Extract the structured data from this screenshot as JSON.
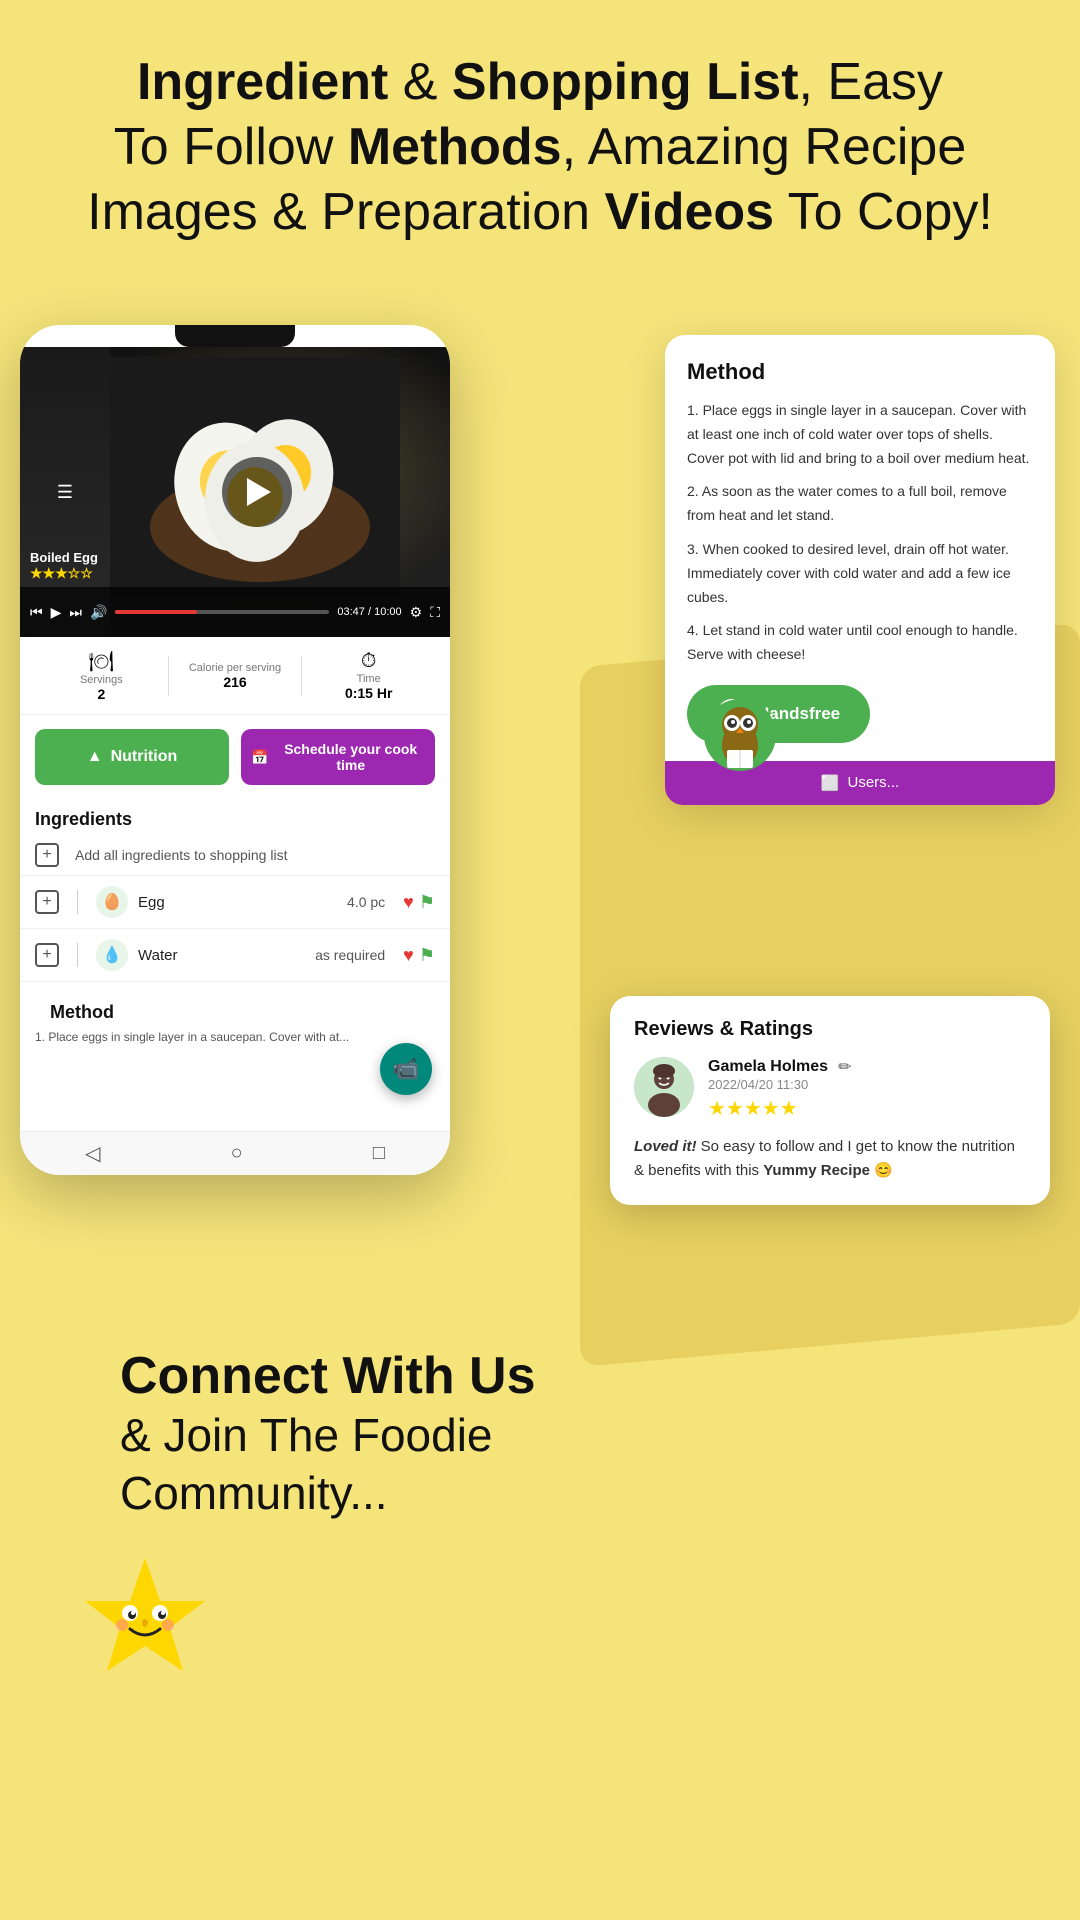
{
  "header": {
    "line1_normal": "Ingredient",
    "line1_connector": " & ",
    "line1_bold": "Shopping List",
    "line1_end": ", Easy",
    "line2_start": "To Follow ",
    "line2_bold": "Methods",
    "line2_end": ", Amazing Recipe",
    "line3_start": "Images & Preparation ",
    "line3_bold": "Videos",
    "line3_end": " To Copy!"
  },
  "recipe": {
    "title": "Boiled Egg",
    "rating_stars": "★★★☆☆",
    "video_time_current": "03:47",
    "video_time_total": "10:00",
    "servings_label": "Servings",
    "servings_value": "2",
    "calorie_label": "Calorie per serving",
    "calorie_value": "216",
    "time_label": "Time",
    "time_value": "0:15 Hr"
  },
  "buttons": {
    "nutrition_label": "Nutrition",
    "schedule_label": "Schedule your cook time",
    "handsfree_label": "Handsfree",
    "add_shopping": "Add all ingredients to shopping list"
  },
  "ingredients": {
    "title": "Ingredients",
    "items": [
      {
        "name": "Egg",
        "quantity": "4.0 pc",
        "icon": "🥚"
      },
      {
        "name": "Water",
        "quantity": "as required",
        "icon": "💧"
      }
    ]
  },
  "method": {
    "title": "Method",
    "steps": [
      "1. Place eggs in single layer in a saucepan. Cover with at least one inch of cold water over tops of shells. Cover pot with lid and bring to a boil over medium heat.",
      "2. As soon as the water comes to a full boil, remove from heat and let stand.",
      "3. When cooked to desired level, drain off hot water. Immediately cover with cold water and add a few ice cubes.",
      "4. Let stand in cold water until cool enough to handle. Serve with cheese!"
    ]
  },
  "review": {
    "section_title": "Reviews & Ratings",
    "reviewer_name": "Gamela Holmes",
    "reviewer_date": "2022/04/20 11:30",
    "stars": "★★★★★",
    "review_bold": "Loved it!",
    "review_text": " So easy to follow and I get to know the nutrition & benefits with this ",
    "review_highlight": "Yummy Recipe",
    "review_emoji": "😊"
  },
  "bottom": {
    "line1": "Connect With Us",
    "line2_normal": "& Join The Foodie",
    "line3": "Community..."
  },
  "colors": {
    "background": "#f5e47a",
    "green": "#4caf50",
    "purple": "#9c27b0",
    "teal": "#00897b",
    "star_gold": "#FFD700"
  }
}
